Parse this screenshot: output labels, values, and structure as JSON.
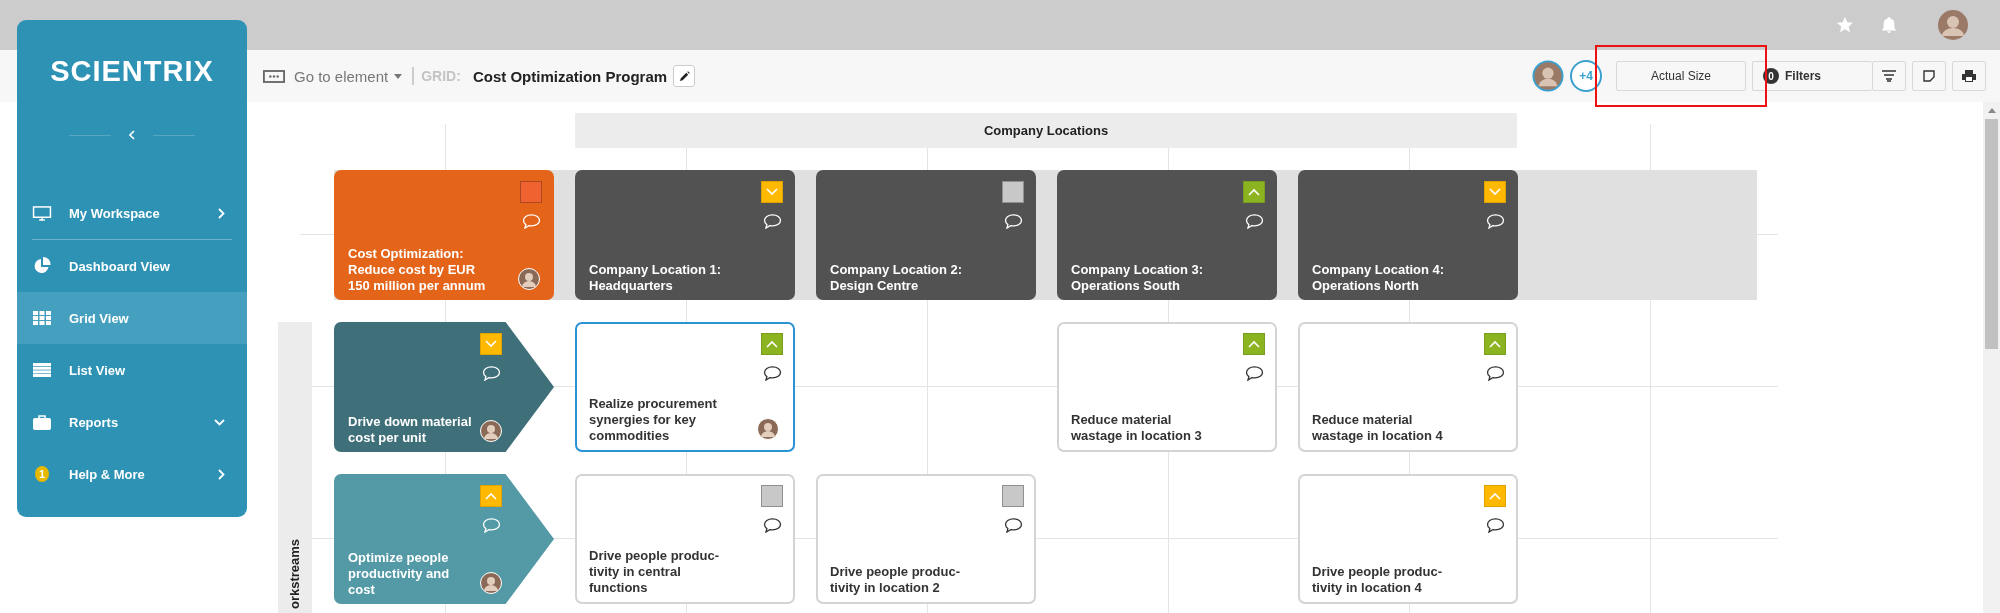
{
  "sidebar": {
    "logo": "SCIENTRIX",
    "items": [
      {
        "kind": "workspace",
        "label": "My Workspace",
        "selected": false
      },
      {
        "kind": "dashboard",
        "label": "Dashboard View",
        "selected": false
      },
      {
        "kind": "grid",
        "label": "Grid View",
        "selected": true
      },
      {
        "kind": "list",
        "label": "List View",
        "selected": false
      },
      {
        "kind": "reports",
        "label": "Reports",
        "selected": false
      },
      {
        "kind": "help",
        "label": "Help & More",
        "selected": false,
        "badge": "1"
      }
    ]
  },
  "toolbar": {
    "goto": "Go to element",
    "grid_label": "GRID:",
    "title": "Cost Optimization Program",
    "more_collaborators": "+4",
    "zoom_button": "Actual Size",
    "filter_count": "0",
    "filters": "Filters"
  },
  "board": {
    "header": "Company Locations",
    "goal": {
      "title": "Cost Optimization:\nReduce cost by EUR\n150 million per annum",
      "indicator": {
        "kind": "flat",
        "color": "#f06330"
      },
      "avatar": true
    },
    "locations": [
      {
        "title": "Company Location 1:\nHeadquarters",
        "indicator": {
          "kind": "down",
          "color": "#ffb900"
        },
        "avatar": false
      },
      {
        "title": "Company Location 2:\nDesign Centre",
        "indicator": {
          "kind": "flat",
          "color": "#c8c8c8"
        },
        "avatar": false
      },
      {
        "title": "Company Location 3:\nOperations South",
        "indicator": {
          "kind": "up",
          "color": "#8cb320"
        },
        "avatar": false
      },
      {
        "title": "Company Location 4:\nOperations North",
        "indicator": {
          "kind": "down",
          "color": "#ffb900"
        },
        "avatar": false
      }
    ],
    "side_label": "orkstreams",
    "rows": [
      {
        "workstream": {
          "title": "Drive down material\ncost per unit",
          "color": "#3f6f79",
          "indicator": {
            "kind": "down",
            "color": "#ffb900"
          },
          "avatar": true
        },
        "cells": [
          {
            "kind": "task",
            "title": "Realize procurement\nsynergies for key\ncommodities",
            "indicator": {
              "kind": "up",
              "color": "#8cb320"
            },
            "avatar": true,
            "selected": true
          },
          {
            "kind": "empty"
          },
          {
            "kind": "task",
            "title": "Reduce material\nwastage in location 3",
            "indicator": {
              "kind": "up",
              "color": "#8cb320"
            },
            "avatar": false,
            "selected": false
          },
          {
            "kind": "task",
            "title": "Reduce material\nwastage in location 4",
            "indicator": {
              "kind": "up",
              "color": "#8cb320"
            },
            "avatar": false,
            "selected": false
          }
        ]
      },
      {
        "workstream": {
          "title": "Optimize people\nproductivity and\ncost",
          "color": "#5399a6",
          "indicator": {
            "kind": "up",
            "color": "#ffb900"
          },
          "avatar": true
        },
        "cells": [
          {
            "kind": "task",
            "title": "Drive people produc-\ntivity in central\nfunctions",
            "indicator": {
              "kind": "flat",
              "color": "#c8c8c8"
            },
            "avatar": false,
            "selected": false
          },
          {
            "kind": "task",
            "title": "Drive people produc-\ntivity in location 2",
            "indicator": {
              "kind": "flat",
              "color": "#c8c8c8"
            },
            "avatar": false,
            "selected": false
          },
          {
            "kind": "empty"
          },
          {
            "kind": "task",
            "title": "Drive people produc-\ntivity in location 4",
            "indicator": {
              "kind": "up",
              "color": "#ffb900"
            },
            "avatar": false,
            "selected": false
          }
        ]
      }
    ]
  }
}
